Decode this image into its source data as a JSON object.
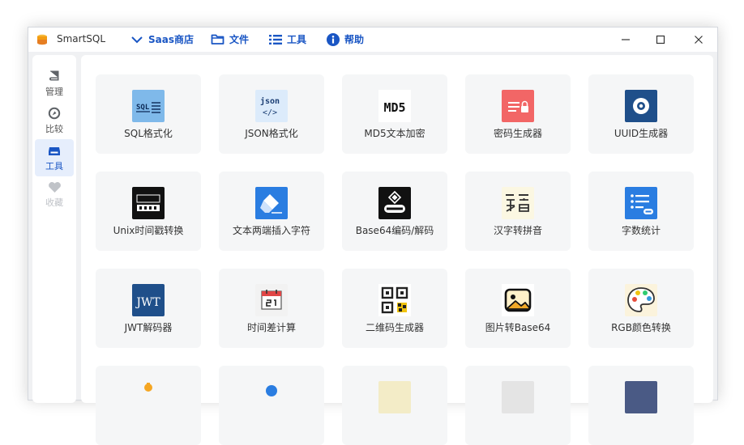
{
  "app": {
    "title": "SmartSQL"
  },
  "menu": {
    "saas": "Saas商店",
    "file": "文件",
    "tools": "工具",
    "help": "帮助"
  },
  "sidebar": {
    "items": [
      {
        "label": "管理",
        "icon": "book-icon"
      },
      {
        "label": "比较",
        "icon": "compare-icon"
      },
      {
        "label": "工具",
        "icon": "toolbox-icon"
      },
      {
        "label": "收藏",
        "icon": "heart-icon"
      }
    ]
  },
  "tools": [
    {
      "label": "SQL格式化",
      "icon": "sql-format-icon",
      "color": "#7fb9ea"
    },
    {
      "label": "JSON格式化",
      "icon": "json-icon",
      "color": "#dcebfb"
    },
    {
      "label": "MD5文本加密",
      "icon": "md5-icon",
      "color": "#ffffff"
    },
    {
      "label": "密码生成器",
      "icon": "password-icon",
      "color": "#f26666"
    },
    {
      "label": "UUID生成器",
      "icon": "uuid-icon",
      "color": "#1f4f8a"
    },
    {
      "label": "Unix时间戳转换",
      "icon": "unix-time-icon",
      "color": "#111111"
    },
    {
      "label": "文本两端插入字符",
      "icon": "eraser-icon",
      "color": "#2a7de1"
    },
    {
      "label": "Base64编码/解码",
      "icon": "base64-icon",
      "color": "#111111"
    },
    {
      "label": "汉字转拼音",
      "icon": "pinyin-icon",
      "color": "#fbf7e2"
    },
    {
      "label": "字数统计",
      "icon": "word-count-icon",
      "color": "#2a7de1"
    },
    {
      "label": "JWT解码器",
      "icon": "jwt-icon",
      "color": "#1f4f8a"
    },
    {
      "label": "时间差计算",
      "icon": "calendar-icon",
      "color": "#f2f2f2"
    },
    {
      "label": "二维码生成器",
      "icon": "qrcode-icon",
      "color": "#ffffff"
    },
    {
      "label": "图片转Base64",
      "icon": "image-icon",
      "color": "#fff1c9"
    },
    {
      "label": "RGB颜色转换",
      "icon": "palette-icon",
      "color": "#fbf3dc"
    },
    {
      "label": "",
      "icon": "partial-icon-orange",
      "color": "#f5a623"
    },
    {
      "label": "",
      "icon": "partial-icon-blue",
      "color": "#2a7de1"
    },
    {
      "label": "",
      "icon": "partial-icon-yellow",
      "color": "#f3ecc7"
    },
    {
      "label": "",
      "icon": "partial-icon-gray",
      "color": "#e4e4e4"
    },
    {
      "label": "",
      "icon": "partial-icon-navy",
      "color": "#4a5a85"
    }
  ]
}
